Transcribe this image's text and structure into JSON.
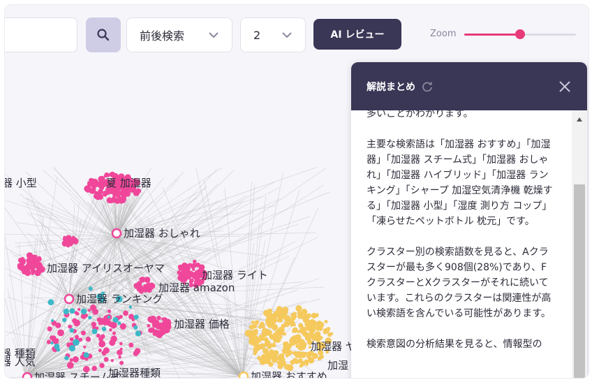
{
  "toolbar": {
    "search_value": "",
    "mode_select": "前後検索",
    "depth_select": "2",
    "ai_review_label": "AI レビュー",
    "zoom_label": "Zoom",
    "zoom_level": 0.5
  },
  "graph": {
    "nodes": [
      {
        "label": "器 小型"
      },
      {
        "label": "夏 加湿器"
      },
      {
        "label": "加湿器 おしゃれ"
      },
      {
        "label": "加湿器 アイリスオーヤマ"
      },
      {
        "label": "加湿器 ライト"
      },
      {
        "label": "加湿器 amazon"
      },
      {
        "label": "加湿器 ランキング"
      },
      {
        "label": "加湿器 価格"
      },
      {
        "label": "器 種類"
      },
      {
        "label": "器 人気"
      },
      {
        "label": "加湿器 スチーム式"
      },
      {
        "label": "加湿器種類"
      },
      {
        "label": "加湿器 おすすめ"
      },
      {
        "label": "加湿器 ヤマダ"
      },
      {
        "label": "加湿"
      }
    ],
    "colors": {
      "pink": "#f0479a",
      "yellow": "#f5c95c",
      "teal": "#3db8c8",
      "edge": "#b5b5b5"
    }
  },
  "panel": {
    "title": "解説まとめ",
    "text": "多いことがわかります。\n\n主要な検索語は「加湿器 おすすめ」「加湿器」「加湿器 スチーム式」「加湿器 おしゃれ」「加湿器 ハイブリッド」「加湿器 ランキング」「シャープ 加湿空気清浄機 乾燥する」「加湿器 小型」「湿度 測り方 コップ」「凍らせたペットボトル 枕元」です。\n\nクラスター別の検索語数を見ると、Aクラスターが最も多く908個(28%)であり、FクラスターとXクラスターがそれに続いています。これらのクラスターは関連性が高い検索語を含んでいる可能性があります。\n\n検索意図の分析結果を見ると、情報型の"
  }
}
